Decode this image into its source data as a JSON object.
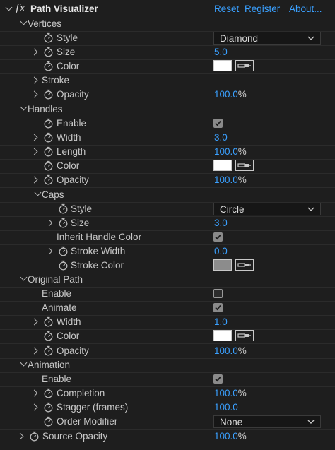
{
  "header": {
    "fx_label": "fx",
    "title": "Path Visualizer",
    "reset": "Reset",
    "register": "Register",
    "about": "About..."
  },
  "groups": {
    "vertices": "Vertices",
    "handles": "Handles",
    "caps": "Caps",
    "original_path": "Original Path",
    "animation": "Animation"
  },
  "vertices": {
    "style_label": "Style",
    "style_value": "Diamond",
    "size_label": "Size",
    "size_value": "5.0",
    "color_label": "Color",
    "color_value": "#ffffff",
    "stroke_label": "Stroke",
    "opacity_label": "Opacity",
    "opacity_value": "100.0",
    "opacity_unit": "%"
  },
  "handles": {
    "enable_label": "Enable",
    "enable_checked": true,
    "width_label": "Width",
    "width_value": "3.0",
    "length_label": "Length",
    "length_value": "100.0",
    "length_unit": "%",
    "color_label": "Color",
    "color_value": "#ffffff",
    "opacity_label": "Opacity",
    "opacity_value": "100.0",
    "opacity_unit": "%"
  },
  "caps": {
    "style_label": "Style",
    "style_value": "Circle",
    "size_label": "Size",
    "size_value": "3.0",
    "inherit_label": "Inherit Handle Color",
    "inherit_checked": true,
    "stroke_width_label": "Stroke Width",
    "stroke_width_value": "0.0",
    "stroke_color_label": "Stroke Color",
    "stroke_color_value": "#8c8c8c"
  },
  "original_path": {
    "enable_label": "Enable",
    "enable_checked": false,
    "animate_label": "Animate",
    "animate_checked": true,
    "width_label": "Width",
    "width_value": "1.0",
    "color_label": "Color",
    "color_value": "#ffffff",
    "opacity_label": "Opacity",
    "opacity_value": "100.0",
    "opacity_unit": "%"
  },
  "animation": {
    "enable_label": "Enable",
    "enable_checked": true,
    "completion_label": "Completion",
    "completion_value": "100.0",
    "completion_unit": "%",
    "stagger_label": "Stagger (frames)",
    "stagger_value": "100.0",
    "order_label": "Order Modifier",
    "order_value": "None"
  },
  "source_opacity": {
    "label": "Source Opacity",
    "value": "100.0",
    "unit": "%"
  },
  "colors": {
    "accent": "#3aa0ff",
    "background": "#1e1e1e",
    "text": "#c8c8c8"
  }
}
